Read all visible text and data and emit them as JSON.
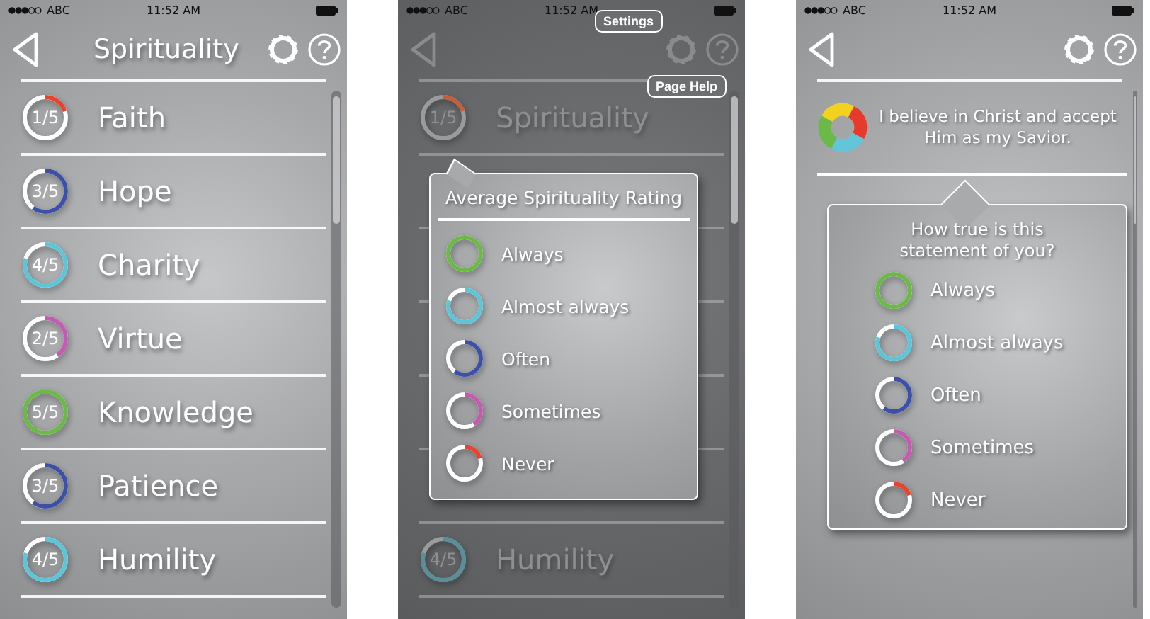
{
  "screens": [
    {
      "kind": "list",
      "status_bar": {
        "carrier": "ABC",
        "time": "11:52 AM"
      },
      "header": {
        "title": "Spirituality"
      },
      "items": [
        {
          "label": "Faith",
          "rating": "1/5",
          "level": 0.2,
          "color": "#e8432e"
        },
        {
          "label": "Hope",
          "rating": "3/5",
          "level": 0.6,
          "color": "#3d50a8"
        },
        {
          "label": "Charity",
          "rating": "4/5",
          "level": 0.8,
          "color": "#5cc5d8"
        },
        {
          "label": "Virtue",
          "rating": "2/5",
          "level": 0.4,
          "color": "#c35bb0"
        },
        {
          "label": "Knowledge",
          "rating": "5/5",
          "level": 1,
          "color": "#6bb947"
        },
        {
          "label": "Patience",
          "rating": "3/5",
          "level": 0.6,
          "color": "#3d50a8"
        },
        {
          "label": "Humility",
          "rating": "4/5",
          "level": 0.8,
          "color": "#5cc5d8"
        }
      ]
    },
    {
      "kind": "legend",
      "status_bar": {
        "carrier": "ABC",
        "time": "11:52 AM"
      },
      "tooltips": [
        "Settings",
        "Page Help"
      ],
      "items": [
        {
          "label": "Spirituality",
          "rating": "1/5",
          "level": 0.2,
          "color": "#c0603e"
        },
        {
          "label": "Humility",
          "rating": "4/5",
          "level": 0.8,
          "color": "#5a8e99"
        }
      ],
      "popup": {
        "title": "Average Spirituality Rating",
        "options": [
          {
            "label": "Always",
            "level": 1,
            "color": "#6bb947"
          },
          {
            "label": "Almost always",
            "level": 0.8,
            "color": "#5cc5d8"
          },
          {
            "label": "Often",
            "level": 0.6,
            "color": "#3d50a8"
          },
          {
            "label": "Sometimes",
            "level": 0.4,
            "color": "#c35bb0"
          },
          {
            "label": "Never",
            "level": 0.2,
            "color": "#e8432e"
          }
        ]
      }
    },
    {
      "kind": "statement",
      "status_bar": {
        "carrier": "ABC",
        "time": "11:52 AM"
      },
      "statement": "I believe in Christ and accept Him as my Savior.",
      "popup": {
        "question": "How true is this statement of you?",
        "options": [
          {
            "label": "Always",
            "level": 1,
            "color": "#6bb947"
          },
          {
            "label": "Almost always",
            "level": 0.8,
            "color": "#5cc5d8"
          },
          {
            "label": "Often",
            "level": 0.6,
            "color": "#3d50a8"
          },
          {
            "label": "Sometimes",
            "level": 0.4,
            "color": "#c35bb0"
          },
          {
            "label": "Never",
            "level": 0.2,
            "color": "#e8432e"
          }
        ]
      }
    }
  ]
}
